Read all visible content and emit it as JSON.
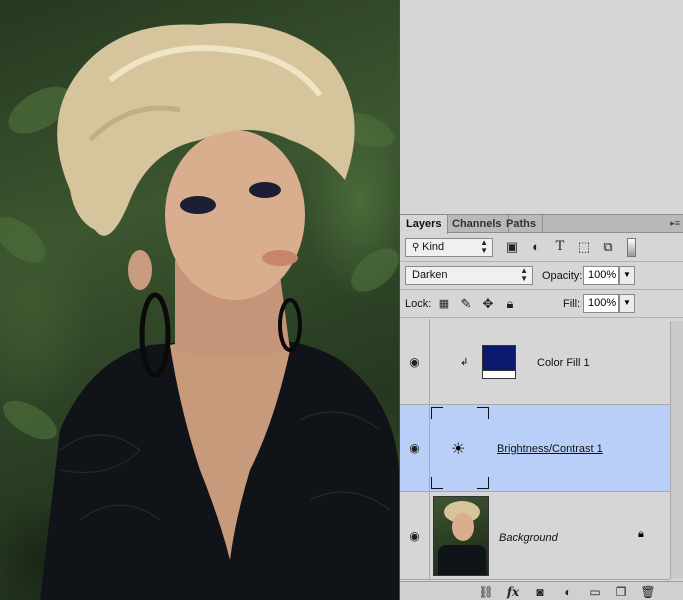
{
  "canvas": {
    "description_icon": "photo-canvas"
  },
  "panel": {
    "tabs": [
      {
        "label": "Layers",
        "active": true
      },
      {
        "label": "Channels",
        "active": false
      },
      {
        "label": "Paths",
        "active": false
      }
    ],
    "filter": {
      "kind_label": "Kind"
    },
    "blend_mode": "Darken",
    "opacity_label": "Opacity:",
    "opacity_value": "100%",
    "lock_label": "Lock:",
    "fill_label": "Fill:",
    "fill_value": "100%",
    "layers": [
      {
        "name": "Color Fill 1",
        "visible": true,
        "selected": false,
        "type": "color-fill",
        "fill_color": "#0b1a6e"
      },
      {
        "name": "Brightness/Contrast 1",
        "visible": true,
        "selected": true,
        "type": "adjustment"
      },
      {
        "name": "Background",
        "visible": true,
        "selected": false,
        "type": "image",
        "locked": true
      }
    ]
  },
  "colors": {
    "panel_bg": "#d6d6d6",
    "selected_layer": "#b9cff8",
    "fill_swatch": "#0b1a6e"
  }
}
